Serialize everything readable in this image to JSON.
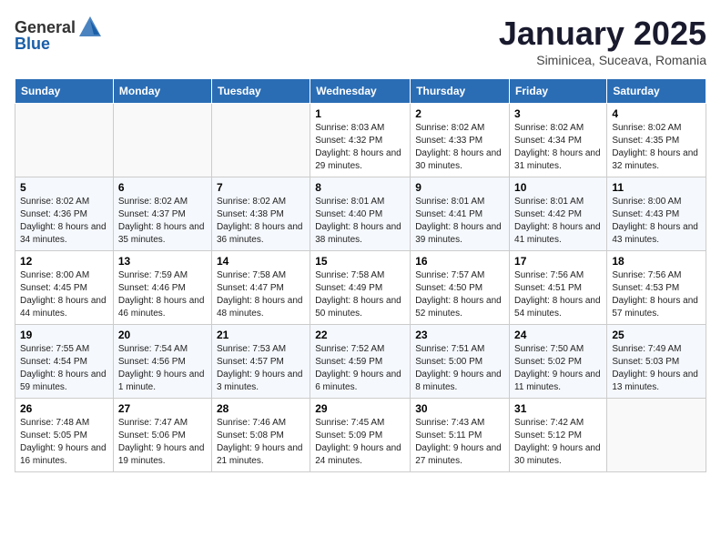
{
  "header": {
    "logo_general": "General",
    "logo_blue": "Blue",
    "month": "January 2025",
    "location": "Siminicea, Suceava, Romania"
  },
  "weekdays": [
    "Sunday",
    "Monday",
    "Tuesday",
    "Wednesday",
    "Thursday",
    "Friday",
    "Saturday"
  ],
  "weeks": [
    [
      {
        "day": "",
        "info": ""
      },
      {
        "day": "",
        "info": ""
      },
      {
        "day": "",
        "info": ""
      },
      {
        "day": "1",
        "info": "Sunrise: 8:03 AM\nSunset: 4:32 PM\nDaylight: 8 hours and 29 minutes."
      },
      {
        "day": "2",
        "info": "Sunrise: 8:02 AM\nSunset: 4:33 PM\nDaylight: 8 hours and 30 minutes."
      },
      {
        "day": "3",
        "info": "Sunrise: 8:02 AM\nSunset: 4:34 PM\nDaylight: 8 hours and 31 minutes."
      },
      {
        "day": "4",
        "info": "Sunrise: 8:02 AM\nSunset: 4:35 PM\nDaylight: 8 hours and 32 minutes."
      }
    ],
    [
      {
        "day": "5",
        "info": "Sunrise: 8:02 AM\nSunset: 4:36 PM\nDaylight: 8 hours and 34 minutes."
      },
      {
        "day": "6",
        "info": "Sunrise: 8:02 AM\nSunset: 4:37 PM\nDaylight: 8 hours and 35 minutes."
      },
      {
        "day": "7",
        "info": "Sunrise: 8:02 AM\nSunset: 4:38 PM\nDaylight: 8 hours and 36 minutes."
      },
      {
        "day": "8",
        "info": "Sunrise: 8:01 AM\nSunset: 4:40 PM\nDaylight: 8 hours and 38 minutes."
      },
      {
        "day": "9",
        "info": "Sunrise: 8:01 AM\nSunset: 4:41 PM\nDaylight: 8 hours and 39 minutes."
      },
      {
        "day": "10",
        "info": "Sunrise: 8:01 AM\nSunset: 4:42 PM\nDaylight: 8 hours and 41 minutes."
      },
      {
        "day": "11",
        "info": "Sunrise: 8:00 AM\nSunset: 4:43 PM\nDaylight: 8 hours and 43 minutes."
      }
    ],
    [
      {
        "day": "12",
        "info": "Sunrise: 8:00 AM\nSunset: 4:45 PM\nDaylight: 8 hours and 44 minutes."
      },
      {
        "day": "13",
        "info": "Sunrise: 7:59 AM\nSunset: 4:46 PM\nDaylight: 8 hours and 46 minutes."
      },
      {
        "day": "14",
        "info": "Sunrise: 7:58 AM\nSunset: 4:47 PM\nDaylight: 8 hours and 48 minutes."
      },
      {
        "day": "15",
        "info": "Sunrise: 7:58 AM\nSunset: 4:49 PM\nDaylight: 8 hours and 50 minutes."
      },
      {
        "day": "16",
        "info": "Sunrise: 7:57 AM\nSunset: 4:50 PM\nDaylight: 8 hours and 52 minutes."
      },
      {
        "day": "17",
        "info": "Sunrise: 7:56 AM\nSunset: 4:51 PM\nDaylight: 8 hours and 54 minutes."
      },
      {
        "day": "18",
        "info": "Sunrise: 7:56 AM\nSunset: 4:53 PM\nDaylight: 8 hours and 57 minutes."
      }
    ],
    [
      {
        "day": "19",
        "info": "Sunrise: 7:55 AM\nSunset: 4:54 PM\nDaylight: 8 hours and 59 minutes."
      },
      {
        "day": "20",
        "info": "Sunrise: 7:54 AM\nSunset: 4:56 PM\nDaylight: 9 hours and 1 minute."
      },
      {
        "day": "21",
        "info": "Sunrise: 7:53 AM\nSunset: 4:57 PM\nDaylight: 9 hours and 3 minutes."
      },
      {
        "day": "22",
        "info": "Sunrise: 7:52 AM\nSunset: 4:59 PM\nDaylight: 9 hours and 6 minutes."
      },
      {
        "day": "23",
        "info": "Sunrise: 7:51 AM\nSunset: 5:00 PM\nDaylight: 9 hours and 8 minutes."
      },
      {
        "day": "24",
        "info": "Sunrise: 7:50 AM\nSunset: 5:02 PM\nDaylight: 9 hours and 11 minutes."
      },
      {
        "day": "25",
        "info": "Sunrise: 7:49 AM\nSunset: 5:03 PM\nDaylight: 9 hours and 13 minutes."
      }
    ],
    [
      {
        "day": "26",
        "info": "Sunrise: 7:48 AM\nSunset: 5:05 PM\nDaylight: 9 hours and 16 minutes."
      },
      {
        "day": "27",
        "info": "Sunrise: 7:47 AM\nSunset: 5:06 PM\nDaylight: 9 hours and 19 minutes."
      },
      {
        "day": "28",
        "info": "Sunrise: 7:46 AM\nSunset: 5:08 PM\nDaylight: 9 hours and 21 minutes."
      },
      {
        "day": "29",
        "info": "Sunrise: 7:45 AM\nSunset: 5:09 PM\nDaylight: 9 hours and 24 minutes."
      },
      {
        "day": "30",
        "info": "Sunrise: 7:43 AM\nSunset: 5:11 PM\nDaylight: 9 hours and 27 minutes."
      },
      {
        "day": "31",
        "info": "Sunrise: 7:42 AM\nSunset: 5:12 PM\nDaylight: 9 hours and 30 minutes."
      },
      {
        "day": "",
        "info": ""
      }
    ]
  ]
}
